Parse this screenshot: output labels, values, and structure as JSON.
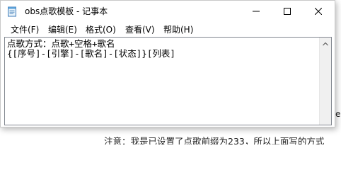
{
  "window": {
    "title": "obs点歌模板 - 记事本"
  },
  "menu": {
    "file": "文件(F)",
    "edit": "编辑(E)",
    "format": "格式(O)",
    "view": "查看(V)",
    "help": "帮助(H)"
  },
  "editor": {
    "content": "点歌方式：点歌+空格+歌名\n{[序号]-[引擎]-[歌名]-[状态]}[列表]"
  },
  "background": {
    "partial_text": "注意：我是已设置了点歌前缀为233，所以上面写的方式",
    "edge_fragment": "e"
  },
  "icons": {
    "app": "notepad-icon",
    "minimize": "minimize-icon",
    "maximize": "maximize-icon",
    "close": "close-icon",
    "scroll_up": "chevron-up-icon"
  }
}
